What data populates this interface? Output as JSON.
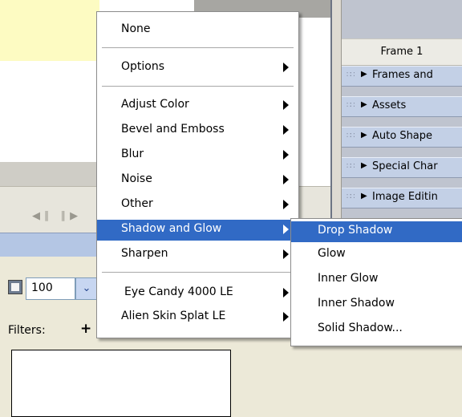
{
  "panels": {
    "frame_title": "Frame 1",
    "rows": [
      "Frames and",
      "Assets",
      "Auto Shape",
      "Special Char",
      "Image Editin"
    ]
  },
  "properties": {
    "opacity_value": "100",
    "filters_label": "Filters:",
    "add_filter_glyph": "+"
  },
  "icons": {
    "timeline_nav": "◀∥ ∥▶",
    "panel_grip": "∷∷",
    "panel_expand": "▶",
    "dropdown": "⌄"
  },
  "menu": {
    "items": [
      "None",
      "Options",
      "Adjust Color",
      "Bevel and Emboss",
      "Blur",
      "Noise",
      "Other",
      "Shadow and Glow",
      "Sharpen",
      "Eye Candy 4000 LE",
      "Alien Skin Splat LE"
    ],
    "highlighted": "Shadow and Glow"
  },
  "submenu": {
    "items": [
      "Drop Shadow",
      "Glow",
      "Inner Glow",
      "Inner Shadow",
      "Solid Shadow..."
    ],
    "highlighted": "Drop Shadow"
  },
  "colors": {
    "highlight": "#316ac5",
    "panel_row": "#c3d0e6",
    "canvas_yellow": "#fdfbc2",
    "properties_bg": "#ece9d8"
  }
}
